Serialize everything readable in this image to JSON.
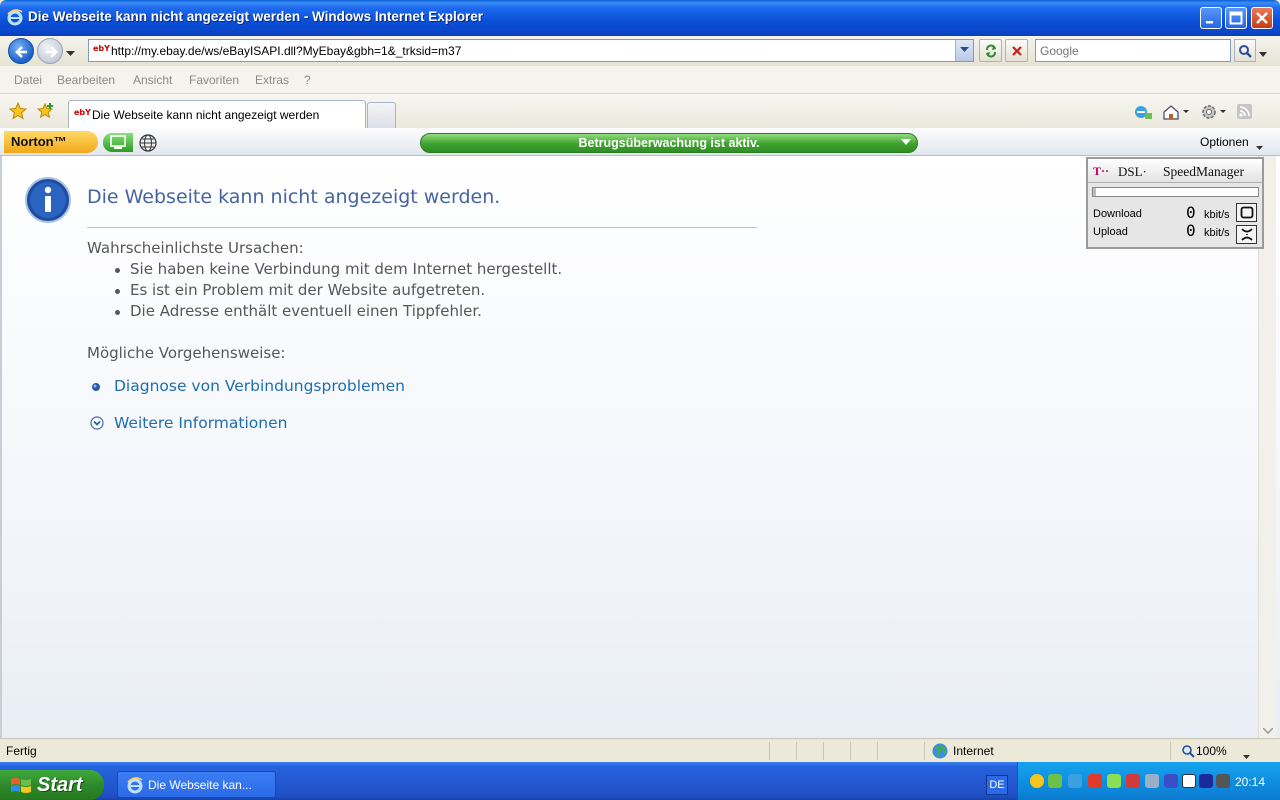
{
  "window": {
    "title": "Die Webseite kann nicht angezeigt werden - Windows Internet Explorer"
  },
  "address": {
    "url": "http://my.ebay.de/ws/eBayISAPI.dll?MyEbay&gbh=1&_trksid=m37",
    "favicon": "ebY",
    "search_placeholder": "Google"
  },
  "menu": {
    "items": [
      "Datei",
      "Bearbeiten",
      "Ansicht",
      "Favoriten",
      "Extras",
      "?"
    ]
  },
  "tabs": [
    {
      "label": "Die Webseite kann nicht angezeigt werden",
      "favicon": "ebY"
    }
  ],
  "norton": {
    "brand": "Norton™",
    "status": "Betrugsüberwachung ist aktiv.",
    "options_label": "Optionen"
  },
  "page": {
    "heading": "Die Webseite kann nicht angezeigt werden.",
    "causes_title": "Wahrscheinlichste Ursachen:",
    "causes": [
      "Sie haben keine Verbindung mit dem Internet hergestellt.",
      "Es ist ein Problem mit der Website aufgetreten.",
      "Die Adresse enthält eventuell einen Tippfehler."
    ],
    "actions_title": "Mögliche Vorgehensweise:",
    "links": [
      "Diagnose von Verbindungsproblemen",
      "Weitere Informationen"
    ]
  },
  "speedmanager": {
    "logo": "T··",
    "product_prefix": "DSL·",
    "product": "SpeedManager",
    "download_label": "Download",
    "upload_label": "Upload",
    "download_value": "0",
    "upload_value": "0",
    "unit": "kbit/s",
    "gauge_level": 0.02
  },
  "statusbar": {
    "status": "Fertig",
    "zone": "Internet",
    "zoom": "100%"
  },
  "taskbar": {
    "start_label": "Start",
    "task_label": "Die Webseite kan...",
    "language": "DE",
    "clock": "20:14"
  },
  "colors": {
    "titlebar": "#0a4fd6",
    "link": "#1f6db0",
    "heading": "#4465a2",
    "norton_bar": "#3ea22f",
    "taskbar": "#2458d0"
  }
}
